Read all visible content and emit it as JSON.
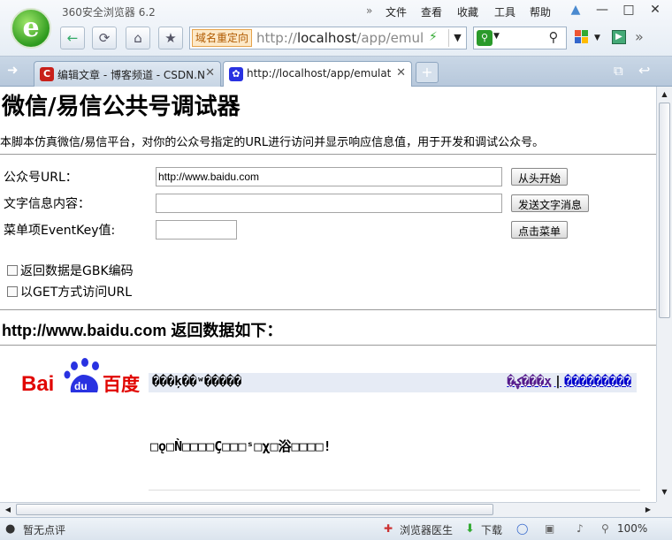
{
  "browser": {
    "title": "360安全浏览器 6.2",
    "menu": [
      "文件",
      "查看",
      "收藏",
      "工具",
      "帮助"
    ],
    "redirect_badge": "域名重定向",
    "url_prefix": "http://",
    "url_host": "localhost",
    "url_rest": "/app/emul",
    "search_placeholder": ""
  },
  "tabs": [
    {
      "label": "编辑文章 - 博客频道 - CSDN.N",
      "active": false
    },
    {
      "label": "http://localhost/app/emulat",
      "active": true
    }
  ],
  "page": {
    "title": "微信/易信公共号调试器",
    "description": "本脚本仿真微信/易信平台，对你的公众号指定的URL进行访问并显示响应信息值，用于开发和调试公众号。",
    "url_label": "公众号URL：",
    "url_value": "http://www.baidu.com",
    "url_button": "从头开始",
    "text_label": "文字信息内容：",
    "text_value": "",
    "text_button": "发送文字消息",
    "menu_label": "菜单项EventKey值:",
    "menu_value": "",
    "menu_button": "点击菜单",
    "gbk_checkbox": "返回数据是GBK编码",
    "get_checkbox": "以GET方式访问URL",
    "result_title": "http://www.baidu.com 返回数据如下：",
    "baidu_brand": "Bai du 百度",
    "garbled_left": "���ķ��ʷ�����",
    "garbled_link1": "�ؼ���ҳ",
    "garbled_sep": "|",
    "garbled_link2": "���������",
    "garbled_body": "□ǫ□Ǹ□□□□Ç□□□ˢ□χ□浴□□□□!"
  },
  "status": {
    "comment": "暂无点评",
    "doctor": "浏览器医生",
    "download": "下载",
    "zoom": "100%"
  },
  "colors": {
    "accent": "#3a9a2a",
    "link": "#0000cc",
    "baidu_red": "#e10602",
    "baidu_blue": "#2932e1"
  }
}
